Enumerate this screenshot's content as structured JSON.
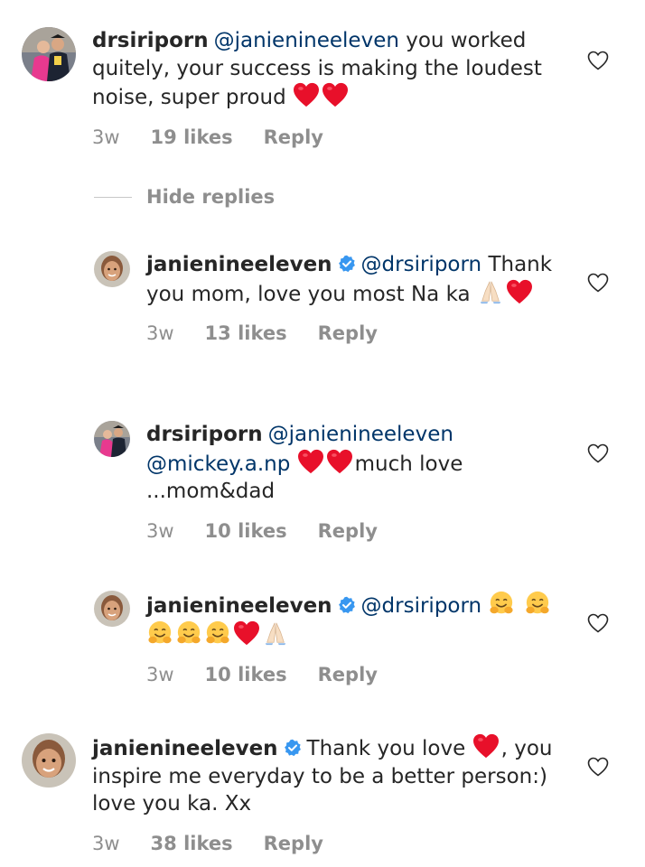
{
  "comments": [
    {
      "username": "drsiriporn",
      "mention": "@janienineeleven",
      "text": "you worked quitely, your success is making the loudest noise, super proud",
      "time": "3w",
      "likes": "19 likes",
      "reply": "Reply"
    },
    {
      "username": "janienineeleven",
      "mention": "@drsiriporn",
      "text": "Thank you mom, love you most Na ka",
      "time": "3w",
      "likes": "13 likes",
      "reply": "Reply"
    },
    {
      "username": "drsiriporn",
      "mention": "@janienineeleven",
      "mention2": "@mickey.a.np",
      "text": "much",
      "text2": "love ...mom&dad",
      "time": "3w",
      "likes": "10 likes",
      "reply": "Reply"
    },
    {
      "username": "janienineeleven",
      "mention": "@drsiriporn",
      "time": "3w",
      "likes": "10 likes",
      "reply": "Reply"
    },
    {
      "username": "janienineeleven",
      "text": "Thank you love",
      "text2": ", you inspire me everyday to be a better person:) love you ka. Xx",
      "time": "3w",
      "likes": "38 likes",
      "reply": "Reply"
    }
  ],
  "hide_replies_label": "Hide replies",
  "colors": {
    "mention": "#003569",
    "meta": "#8e8e8e",
    "verified": "#3897f0",
    "heart_emoji": "#e8102a"
  },
  "icons": [
    "heart-outline-icon",
    "verified-badge-icon",
    "red-heart-emoji",
    "folded-hands-emoji",
    "hugging-face-emoji"
  ]
}
